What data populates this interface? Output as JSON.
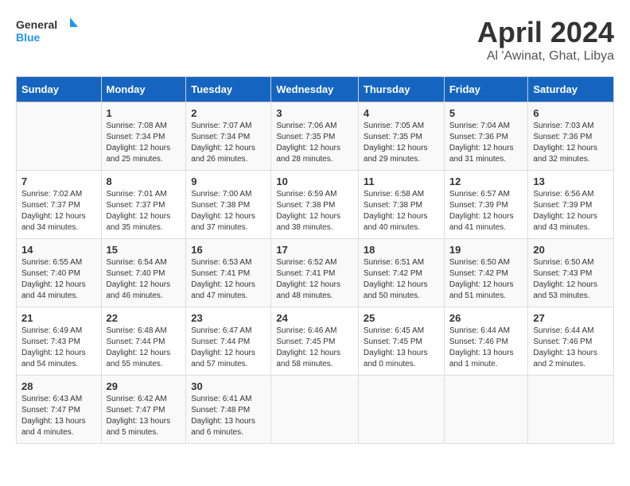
{
  "header": {
    "logo_general": "General",
    "logo_blue": "Blue",
    "title": "April 2024",
    "subtitle": "Al 'Awinat, Ghat, Libya"
  },
  "days_of_week": [
    "Sunday",
    "Monday",
    "Tuesday",
    "Wednesday",
    "Thursday",
    "Friday",
    "Saturday"
  ],
  "weeks": [
    [
      {
        "date": "",
        "sunrise": "",
        "sunset": "",
        "daylight": ""
      },
      {
        "date": "1",
        "sunrise": "7:08 AM",
        "sunset": "7:34 PM",
        "daylight": "12 hours and 25 minutes."
      },
      {
        "date": "2",
        "sunrise": "7:07 AM",
        "sunset": "7:34 PM",
        "daylight": "12 hours and 26 minutes."
      },
      {
        "date": "3",
        "sunrise": "7:06 AM",
        "sunset": "7:35 PM",
        "daylight": "12 hours and 28 minutes."
      },
      {
        "date": "4",
        "sunrise": "7:05 AM",
        "sunset": "7:35 PM",
        "daylight": "12 hours and 29 minutes."
      },
      {
        "date": "5",
        "sunrise": "7:04 AM",
        "sunset": "7:36 PM",
        "daylight": "12 hours and 31 minutes."
      },
      {
        "date": "6",
        "sunrise": "7:03 AM",
        "sunset": "7:36 PM",
        "daylight": "12 hours and 32 minutes."
      }
    ],
    [
      {
        "date": "7",
        "sunrise": "7:02 AM",
        "sunset": "7:37 PM",
        "daylight": "12 hours and 34 minutes."
      },
      {
        "date": "8",
        "sunrise": "7:01 AM",
        "sunset": "7:37 PM",
        "daylight": "12 hours and 35 minutes."
      },
      {
        "date": "9",
        "sunrise": "7:00 AM",
        "sunset": "7:38 PM",
        "daylight": "12 hours and 37 minutes."
      },
      {
        "date": "10",
        "sunrise": "6:59 AM",
        "sunset": "7:38 PM",
        "daylight": "12 hours and 38 minutes."
      },
      {
        "date": "11",
        "sunrise": "6:58 AM",
        "sunset": "7:38 PM",
        "daylight": "12 hours and 40 minutes."
      },
      {
        "date": "12",
        "sunrise": "6:57 AM",
        "sunset": "7:39 PM",
        "daylight": "12 hours and 41 minutes."
      },
      {
        "date": "13",
        "sunrise": "6:56 AM",
        "sunset": "7:39 PM",
        "daylight": "12 hours and 43 minutes."
      }
    ],
    [
      {
        "date": "14",
        "sunrise": "6:55 AM",
        "sunset": "7:40 PM",
        "daylight": "12 hours and 44 minutes."
      },
      {
        "date": "15",
        "sunrise": "6:54 AM",
        "sunset": "7:40 PM",
        "daylight": "12 hours and 46 minutes."
      },
      {
        "date": "16",
        "sunrise": "6:53 AM",
        "sunset": "7:41 PM",
        "daylight": "12 hours and 47 minutes."
      },
      {
        "date": "17",
        "sunrise": "6:52 AM",
        "sunset": "7:41 PM",
        "daylight": "12 hours and 48 minutes."
      },
      {
        "date": "18",
        "sunrise": "6:51 AM",
        "sunset": "7:42 PM",
        "daylight": "12 hours and 50 minutes."
      },
      {
        "date": "19",
        "sunrise": "6:50 AM",
        "sunset": "7:42 PM",
        "daylight": "12 hours and 51 minutes."
      },
      {
        "date": "20",
        "sunrise": "6:50 AM",
        "sunset": "7:43 PM",
        "daylight": "12 hours and 53 minutes."
      }
    ],
    [
      {
        "date": "21",
        "sunrise": "6:49 AM",
        "sunset": "7:43 PM",
        "daylight": "12 hours and 54 minutes."
      },
      {
        "date": "22",
        "sunrise": "6:48 AM",
        "sunset": "7:44 PM",
        "daylight": "12 hours and 55 minutes."
      },
      {
        "date": "23",
        "sunrise": "6:47 AM",
        "sunset": "7:44 PM",
        "daylight": "12 hours and 57 minutes."
      },
      {
        "date": "24",
        "sunrise": "6:46 AM",
        "sunset": "7:45 PM",
        "daylight": "12 hours and 58 minutes."
      },
      {
        "date": "25",
        "sunrise": "6:45 AM",
        "sunset": "7:45 PM",
        "daylight": "13 hours and 0 minutes."
      },
      {
        "date": "26",
        "sunrise": "6:44 AM",
        "sunset": "7:46 PM",
        "daylight": "13 hours and 1 minute."
      },
      {
        "date": "27",
        "sunrise": "6:44 AM",
        "sunset": "7:46 PM",
        "daylight": "13 hours and 2 minutes."
      }
    ],
    [
      {
        "date": "28",
        "sunrise": "6:43 AM",
        "sunset": "7:47 PM",
        "daylight": "13 hours and 4 minutes."
      },
      {
        "date": "29",
        "sunrise": "6:42 AM",
        "sunset": "7:47 PM",
        "daylight": "13 hours and 5 minutes."
      },
      {
        "date": "30",
        "sunrise": "6:41 AM",
        "sunset": "7:48 PM",
        "daylight": "13 hours and 6 minutes."
      },
      {
        "date": "",
        "sunrise": "",
        "sunset": "",
        "daylight": ""
      },
      {
        "date": "",
        "sunrise": "",
        "sunset": "",
        "daylight": ""
      },
      {
        "date": "",
        "sunrise": "",
        "sunset": "",
        "daylight": ""
      },
      {
        "date": "",
        "sunrise": "",
        "sunset": "",
        "daylight": ""
      }
    ]
  ]
}
